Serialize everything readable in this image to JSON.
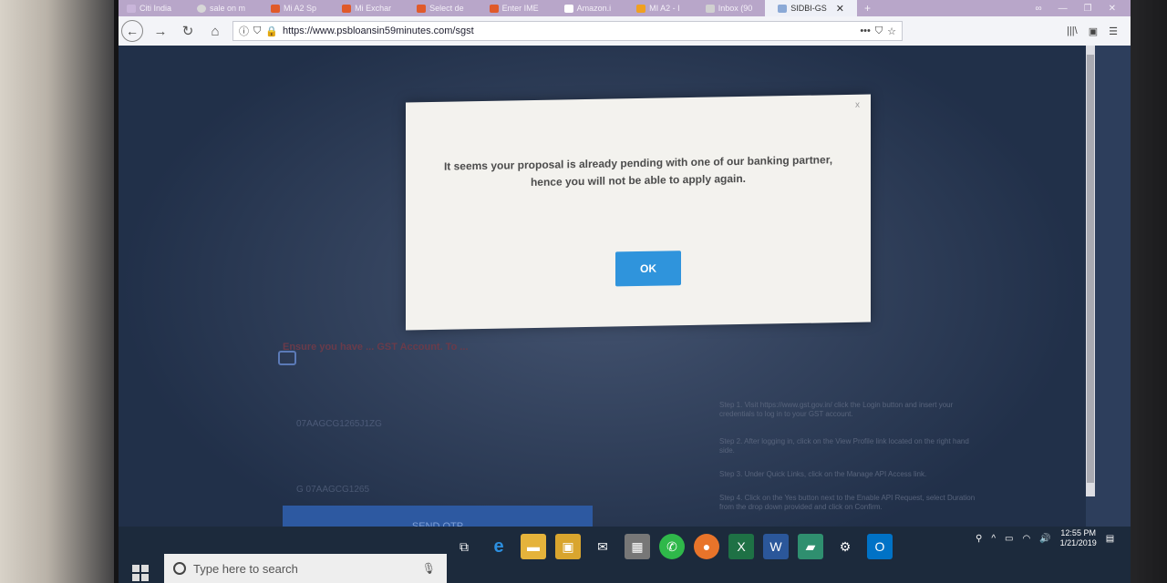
{
  "browser": {
    "tabs": [
      {
        "label": "Citi India",
        "color": "#c9b5da"
      },
      {
        "label": "sale on m",
        "color": "#d7d7d7"
      },
      {
        "label": "Mi A2 Sp",
        "color": "#e05a2a"
      },
      {
        "label": "Mi Exchar",
        "color": "#e05a2a"
      },
      {
        "label": "Select de",
        "color": "#e05a2a"
      },
      {
        "label": "Enter IME",
        "color": "#e05a2a"
      },
      {
        "label": "Amazon.i",
        "color": "#ffffff"
      },
      {
        "label": "MI A2 - I",
        "color": "#f0a020"
      },
      {
        "label": "Inbox (90",
        "color": "#d0d0d0"
      },
      {
        "label": "SIDBI-GS",
        "color": "#8ba9d6",
        "active": true
      }
    ],
    "tab_close": "✕",
    "new_tab": "+",
    "window_controls": [
      "∞",
      "—",
      "❐",
      "✕"
    ],
    "url": "https://www.psbloansin59minutes.com/sgst",
    "url_icons": {
      "info": "ⓘ",
      "shield": "⛉",
      "lock": "🔒",
      "menu": "•••",
      "pocket": "⛉",
      "star": "☆"
    },
    "nav": {
      "back": "←",
      "forward": "→",
      "reload": "↻",
      "home": "⌂"
    },
    "toolbar_right": {
      "library": "|||\\",
      "sidebar": "▣",
      "menu": "☰"
    }
  },
  "page": {
    "warning_text": "Ensure you have ... GST Account. To ...",
    "gst_number_1": "07AAGCG1265J1ZG",
    "gst_number_2": "G 07AAGCG1265",
    "steps": [
      "Step 1. Visit https://www.gst.gov.in/ click the Login button and insert your credentials to log in to your GST account.",
      "Step 2. After logging in, click on the View Profile link located on the right hand side.",
      "Step 3. Under Quick Links, click on the Manage API Access link.",
      "Step 4. Click on the Yes button next to the Enable API Request, select Duration from the drop down provided and click on Confirm."
    ],
    "send_otp_label": "SEND OTP"
  },
  "modal": {
    "close": "x",
    "message": "It seems your proposal is already pending with one of our banking partner, hence you will not be able to apply again.",
    "ok_label": "OK"
  },
  "taskbar": {
    "search_placeholder": "Type here to search",
    "icons": [
      "task-view",
      "edge",
      "file-explorer",
      "store",
      "mail",
      "calculator",
      "whatsapp",
      "firefox",
      "excel",
      "word",
      "photos",
      "settings",
      "outlook"
    ],
    "tray": {
      "up_arrow": "^",
      "time": "12:55 PM",
      "date": "1/21/2019"
    }
  }
}
